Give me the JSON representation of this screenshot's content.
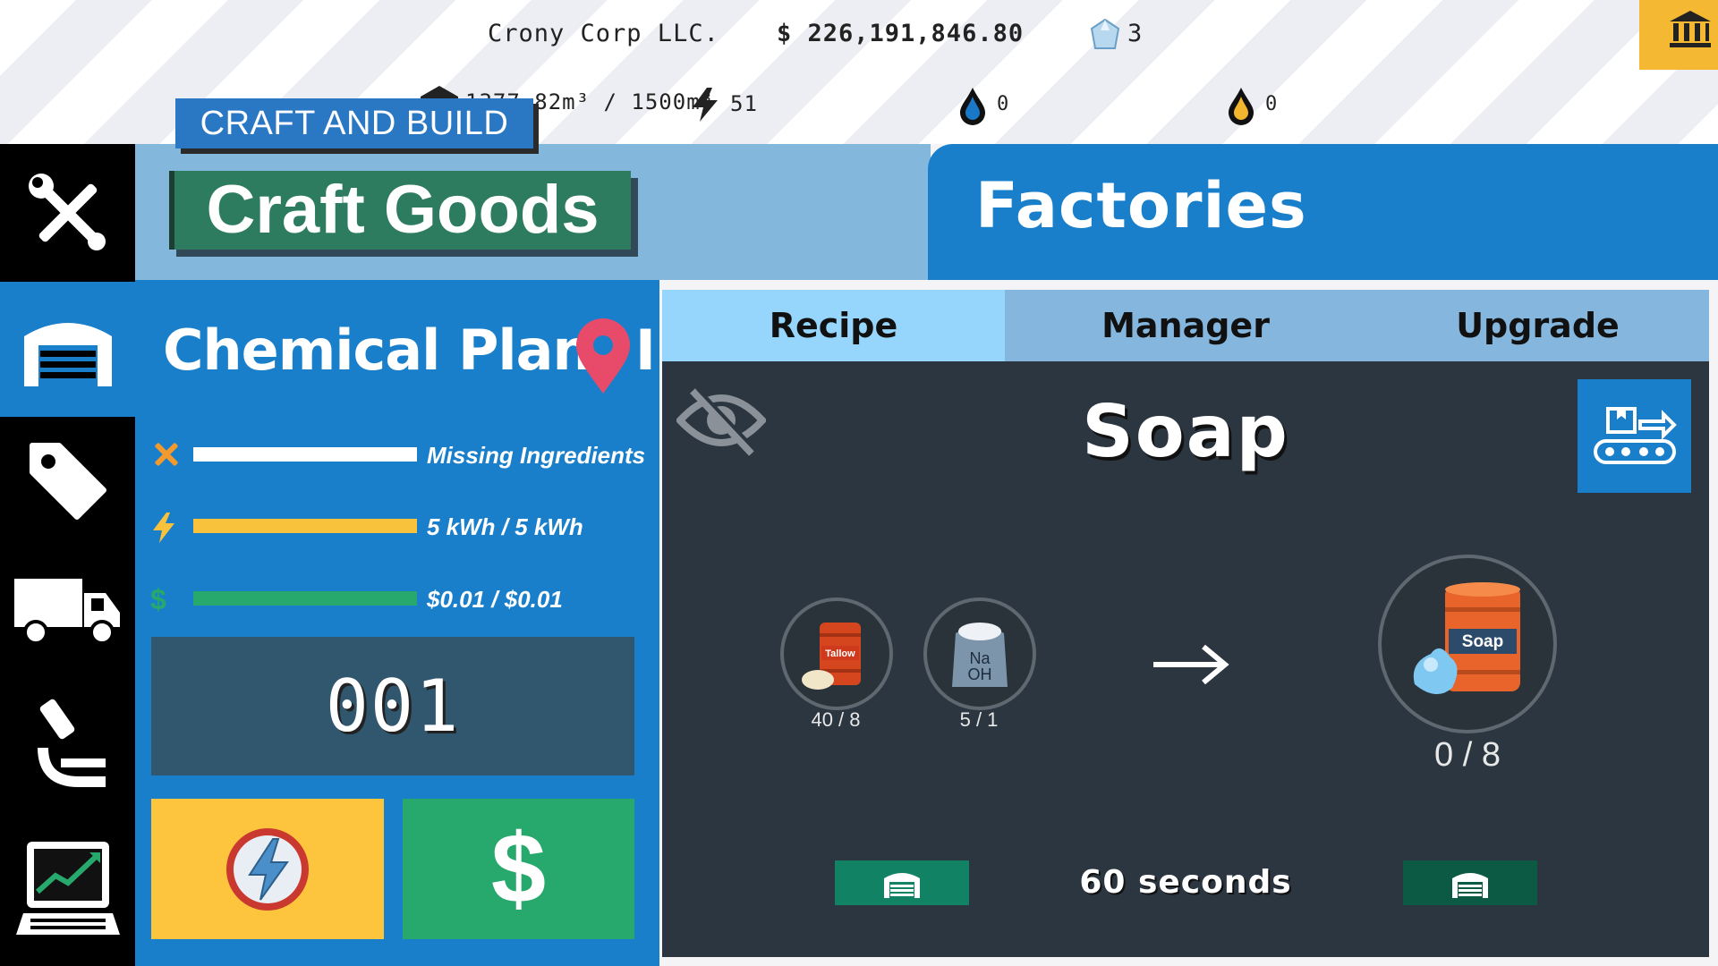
{
  "status_bar": {
    "company_name": "Crony Corp LLC.",
    "money": "$ 226,191,846.80",
    "gems": "3",
    "storage": "1377.82m³ / 1500m³",
    "energy": "51",
    "water": "0",
    "oil": "0"
  },
  "header": {
    "craft_build_label": "CRAFT AND BUILD",
    "section_title": "Craft Goods",
    "panel_title": "Factories"
  },
  "factory": {
    "name": "Chemical Plant I",
    "stats": [
      {
        "label": "Missing Ingredients",
        "fill": 1.0,
        "color": "#ffffff"
      },
      {
        "label": "5 kWh / 5 kWh",
        "fill": 1.0,
        "color": "#f9c23c"
      },
      {
        "label": "$0.01 / $0.01",
        "fill": 1.0,
        "color": "#27a86c"
      }
    ],
    "counter": "001",
    "sell_label": "$"
  },
  "tabs": [
    "Recipe",
    "Manager",
    "Upgrade"
  ],
  "recipe": {
    "product": "Soap",
    "ingredients": [
      {
        "name": "Tallow",
        "count": "40 / 8"
      },
      {
        "name": "NaOH",
        "count": "5 / 1"
      }
    ],
    "output": {
      "name": "Soap",
      "count": "0 / 8"
    },
    "duration": "60 seconds"
  },
  "colors": {
    "accent_blue": "#1a7fcb",
    "tab_active": "#97d6fc",
    "panel_dark": "#2c3640",
    "green": "#27a86c",
    "yellow": "#fdc53d"
  }
}
